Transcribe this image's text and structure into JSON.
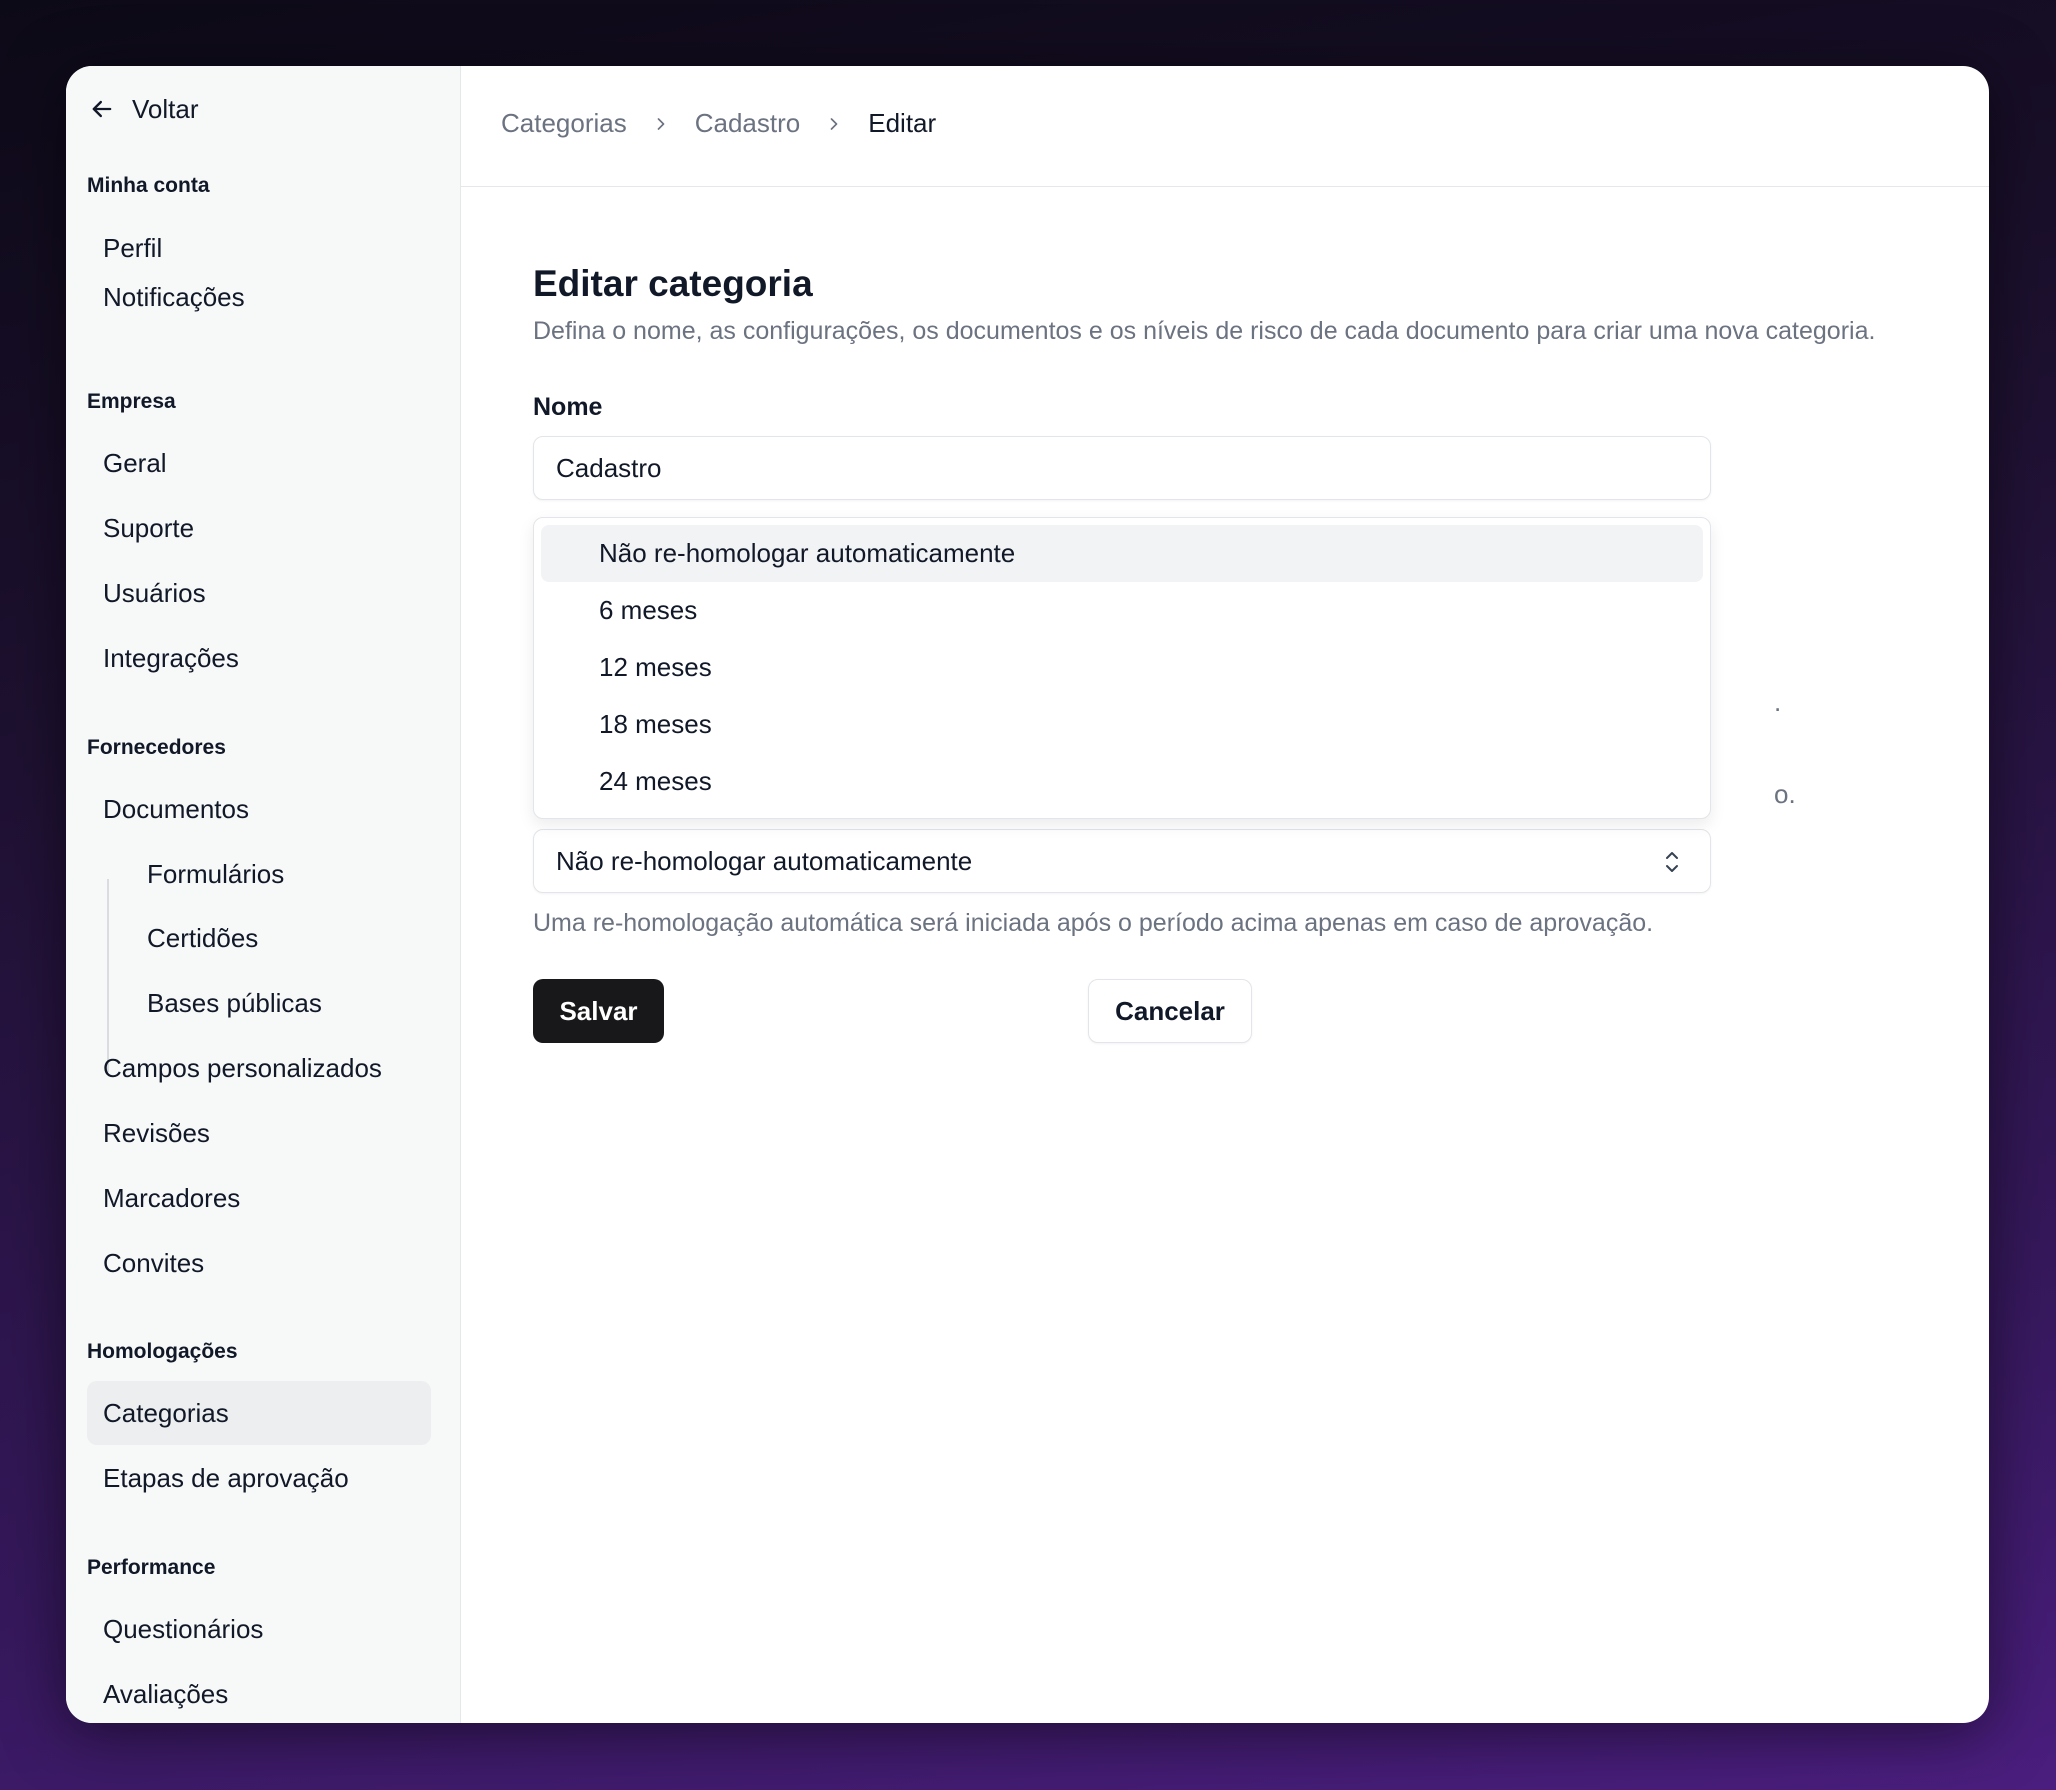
{
  "sidebar": {
    "back_label": "Voltar",
    "sections": {
      "account": {
        "title": "Minha conta",
        "items": [
          "Perfil",
          "Notificações"
        ]
      },
      "company": {
        "title": "Empresa",
        "items": [
          "Geral",
          "Suporte",
          "Usuários",
          "Integrações"
        ]
      },
      "suppliers": {
        "title": "Fornecedores",
        "items": [
          "Documentos",
          "Formulários",
          "Certidões",
          "Bases públicas",
          "Campos personalizados",
          "Revisões",
          "Marcadores",
          "Convites"
        ]
      },
      "approvals": {
        "title": "Homologações",
        "items": [
          "Categorias",
          "Etapas de aprovação"
        ],
        "active": "Categorias"
      },
      "performance": {
        "title": "Performance",
        "items": [
          "Questionários",
          "Avaliações"
        ]
      }
    }
  },
  "breadcrumb": [
    "Categorias",
    "Cadastro",
    "Editar"
  ],
  "form": {
    "title": "Editar categoria",
    "description": "Defina o nome, as configurações, os documentos e os níveis de risco de cada documento para criar uma nova categoria.",
    "name_label": "Nome",
    "name_value": "Cadastro",
    "hidden_fragments": [
      ".",
      "o."
    ],
    "rehomologation": {
      "selected": "Não re-homologar automaticamente",
      "options": [
        "Não re-homologar automaticamente",
        "6 meses",
        "12 meses",
        "18 meses",
        "24 meses"
      ],
      "help": "Uma re-homologação automática será iniciada após o período acima apenas em caso de aprovação."
    },
    "save_label": "Salvar",
    "cancel_label": "Cancelar"
  },
  "colors": {
    "primary_button": "#18181b",
    "active_nav": "#eceeef",
    "option_highlight": "#f2f3f5"
  }
}
